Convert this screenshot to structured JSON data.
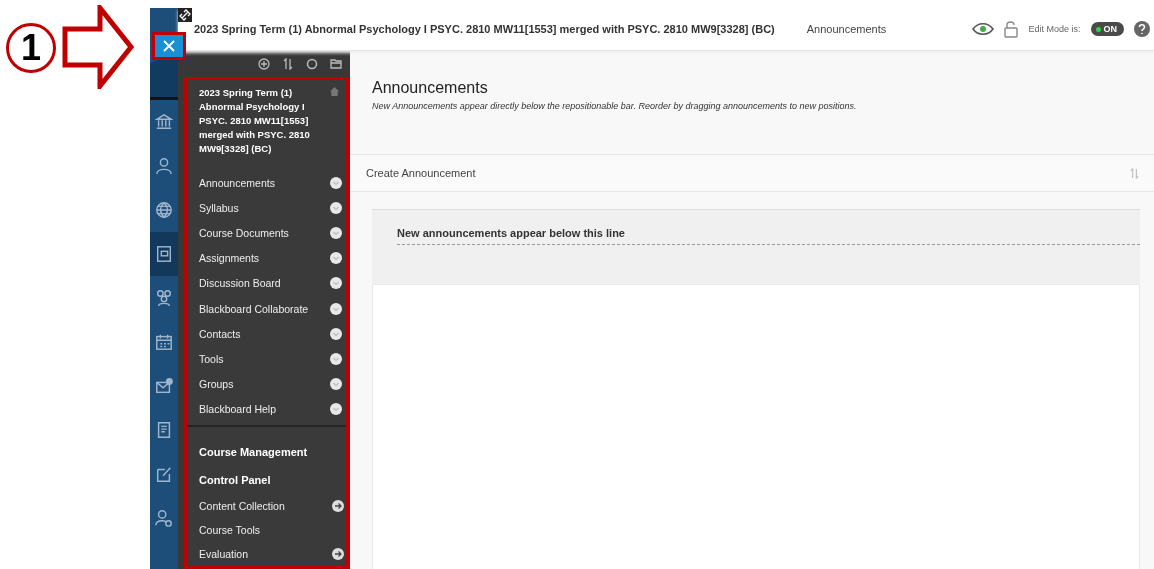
{
  "annotation": {
    "step": "1"
  },
  "top_bar": {
    "course_title": "2023 Spring Term (1) Abnormal Psychology I PSYC. 2810 MW11[1553] merged with PSYC. 2810 MW9[3328] (BC)",
    "page": "Announcements",
    "edit_mode_label": "Edit Mode is:",
    "edit_mode": {
      "label": "ON",
      "on": true
    }
  },
  "rail_items": [
    {
      "kind": "institution",
      "selected": false
    },
    {
      "kind": "profile",
      "selected": false
    },
    {
      "kind": "globe",
      "selected": false
    },
    {
      "kind": "courses",
      "selected": true
    },
    {
      "kind": "groups",
      "selected": false
    },
    {
      "kind": "calendar",
      "selected": false
    },
    {
      "kind": "messages",
      "selected": false
    },
    {
      "kind": "grades",
      "selected": false
    },
    {
      "kind": "edit",
      "selected": false
    },
    {
      "kind": "tools",
      "selected": false
    }
  ],
  "course_menu": {
    "title": "2023 Spring Term (1) Abnormal Psychology I PSYC. 2810 MW11[1553] merged with PSYC. 2810 MW9[3328] (BC)",
    "items": [
      {
        "label": "Announcements"
      },
      {
        "label": "Syllabus"
      },
      {
        "label": "Course Documents"
      },
      {
        "label": "Assignments"
      },
      {
        "label": "Discussion Board"
      },
      {
        "label": "Blackboard Collaborate"
      },
      {
        "label": "Contacts"
      },
      {
        "label": "Tools"
      },
      {
        "label": "Groups"
      },
      {
        "label": "Blackboard Help"
      }
    ],
    "management_heading": "Course Management",
    "control_panel": "Control Panel",
    "control_items": [
      {
        "label": "Content Collection",
        "has_submenu": true
      },
      {
        "label": "Course Tools",
        "has_submenu": false
      },
      {
        "label": "Evaluation",
        "has_submenu": true
      }
    ]
  },
  "content": {
    "title": "Announcements",
    "subtitle": "New Announcements appear directly below the repositionable bar. Reorder by dragging announcements to new positions.",
    "create_button": "Create Announcement",
    "divider_text": "New announcements appear below this line"
  }
}
